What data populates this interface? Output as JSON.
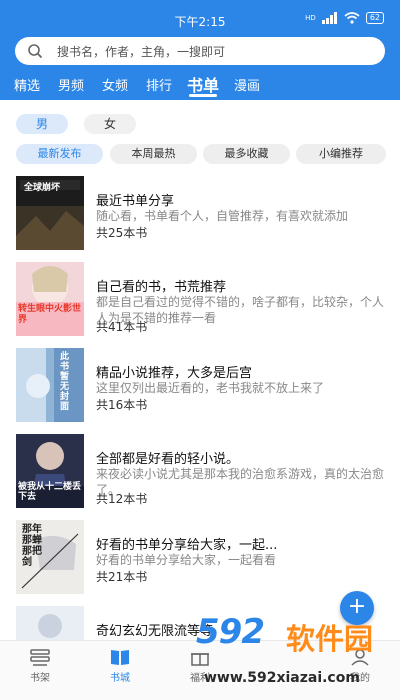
{
  "status_bar": {
    "time": "下午2:15",
    "network": "HD",
    "battery": "62"
  },
  "search": {
    "placeholder": "搜书名，作者，主角，一搜即可"
  },
  "category_tabs": [
    {
      "label": "精选"
    },
    {
      "label": "男频"
    },
    {
      "label": "女频"
    },
    {
      "label": "排行"
    },
    {
      "label": "书单",
      "active": true
    },
    {
      "label": "漫画"
    }
  ],
  "gender_filters": [
    {
      "label": "男",
      "active": true
    },
    {
      "label": "女"
    }
  ],
  "sort_filters": [
    {
      "label": "最新发布",
      "active": true
    },
    {
      "label": "本周最热"
    },
    {
      "label": "最多收藏"
    },
    {
      "label": "小编推荐"
    }
  ],
  "book_lists": [
    {
      "title": "最近书单分享",
      "desc": "随心看，书单看个人，自管推荐，有喜欢就添加",
      "count": "共25本书",
      "cover_text": "全球崩坏"
    },
    {
      "title": "自己看的书，书荒推荐",
      "desc": "都是自己看过的觉得不错的，啥子都有，比较杂，个人人为是不错的推荐一看",
      "count": "共41本书",
      "cover_text": "转生眼中火影世界"
    },
    {
      "title": "精品小说推荐，大多是后宫",
      "desc": "这里仅列出最近看的，老书我就不放上来了",
      "count": "共16本书",
      "cover_text": "此书暂无封面"
    },
    {
      "title": "全部都是好看的轻小说。",
      "desc": "来夜必读小说尤其是那本我的治愈系游戏，真的太治愈了。",
      "count": "共12本书",
      "cover_text": "被我从十二楼丢下去"
    },
    {
      "title": "好看的书单分享给大家，一起...",
      "desc": "好看的书单分享给大家，一起看看",
      "count": "共21本书",
      "cover_text": "那年那蝉那把剑"
    },
    {
      "title": "奇幻玄幻无限流等等",
      "desc": "",
      "count": "",
      "cover_text": ""
    }
  ],
  "fab": {
    "label": "+"
  },
  "bottom_tabs": [
    {
      "label": "书架"
    },
    {
      "label": "书城",
      "active": true
    },
    {
      "label": "福利"
    },
    {
      "label": "我的"
    }
  ],
  "watermark": {
    "big": "592",
    "cn": "软件园",
    "url": "www.592xiazai.com"
  },
  "colors": {
    "primary": "#2c86e8",
    "watermark_orange": "#ff8c1a"
  }
}
